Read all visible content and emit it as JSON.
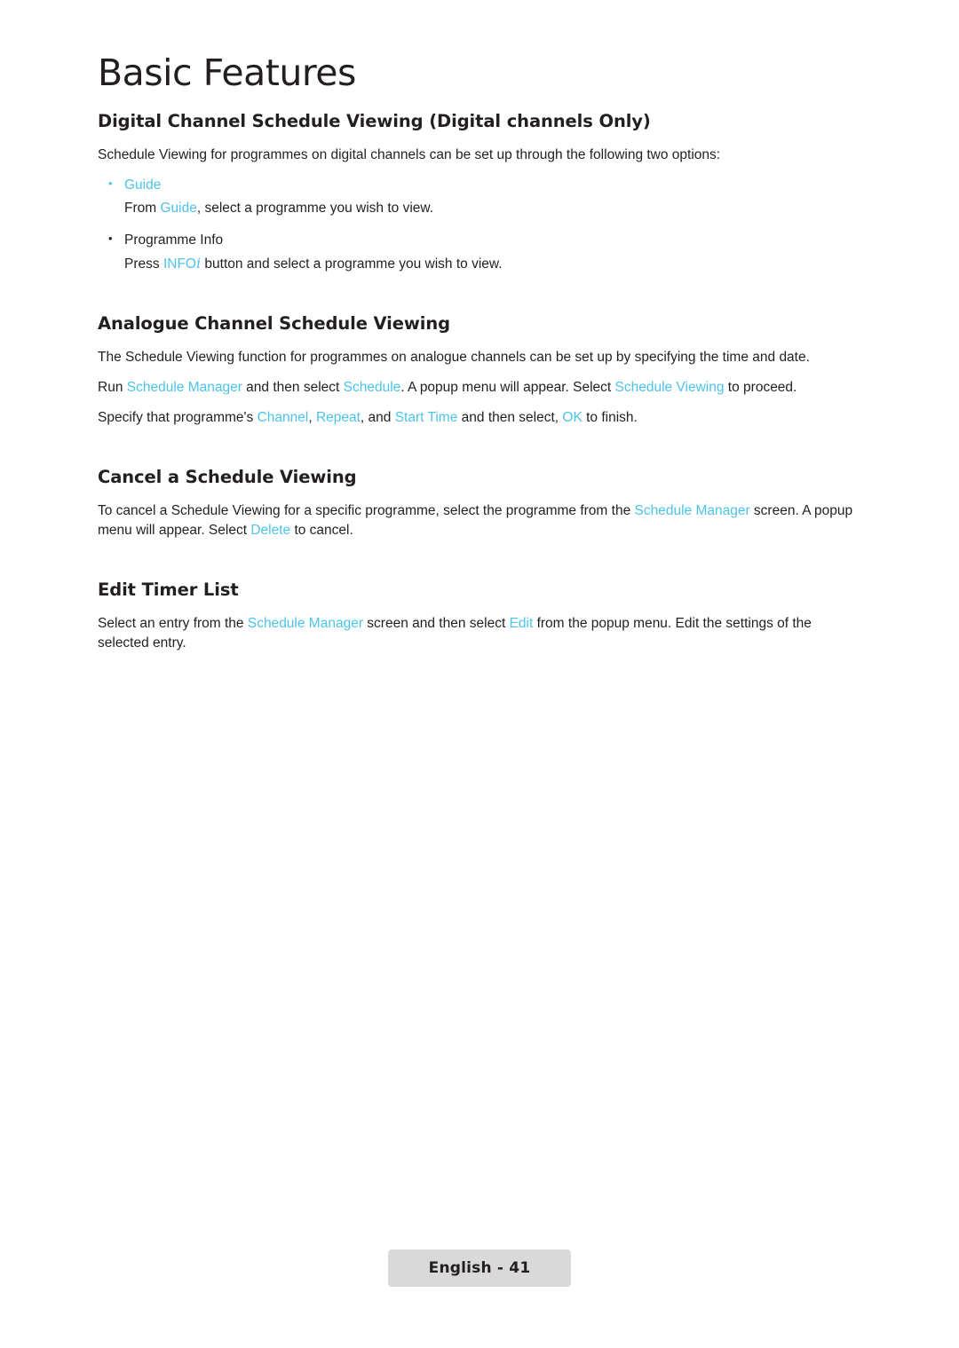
{
  "document": {
    "title": "Basic Features",
    "footer_badge": "English - 41"
  },
  "sections": [
    {
      "heading": "Digital Channel Schedule Viewing (Digital channels Only)",
      "intro": "Schedule Viewing for programmes on digital channels can be set up through the following two options:",
      "bullets": [
        {
          "label": "Guide",
          "highlight": true
        },
        {
          "label": "Programme Info",
          "highlight": false
        }
      ],
      "guide_line_prefix": "From ",
      "guide_line_link": "Guide",
      "guide_line_suffix": ", select a programme you wish to view.",
      "info_line_prefix": "Press ",
      "info_line_key": "INFO",
      "info_line_icon": "i",
      "info_line_suffix": " button and select a programme you wish to view."
    },
    {
      "heading": "Analogue Channel Schedule Viewing",
      "paragraph1": "The Schedule Viewing function for programmes on analogue channels can be set up by specifying the time and date.",
      "run_prefix": "Run ",
      "run_link1": "Schedule Manager",
      "run_mid1": " and then select ",
      "run_link2": "Schedule",
      "run_mid2": ". A popup menu will appear. Select ",
      "run_link3": "Schedule Viewing",
      "run_suffix": " to proceed.",
      "specify_prefix": "Specify that programme's ",
      "specify_link1": "Channel",
      "specify_mid1": ", ",
      "specify_link2": "Repeat",
      "specify_mid2": ", and ",
      "specify_link3": "Start Time",
      "specify_mid3": " and then select, ",
      "specify_link4": "OK",
      "specify_suffix": " to finish."
    },
    {
      "heading": "Cancel a Schedule Viewing",
      "cancel_prefix": "To cancel a Schedule Viewing for a specific programme, select the programme from the ",
      "cancel_link1": "Schedule Manager",
      "cancel_mid1": " screen. A popup menu will appear. Select ",
      "cancel_link2": "Delete",
      "cancel_suffix": " to cancel."
    },
    {
      "heading": "Edit Timer List",
      "edit_prefix": "Select an entry from the ",
      "edit_link1": "Schedule Manager",
      "edit_mid1": " screen and then select ",
      "edit_link2": "Edit",
      "edit_suffix": " from the popup menu. Edit the settings of the selected entry."
    }
  ],
  "colors": {
    "accent": "#4cc3e8",
    "text": "#231f20",
    "badge_bg": "#d9d9d9"
  }
}
